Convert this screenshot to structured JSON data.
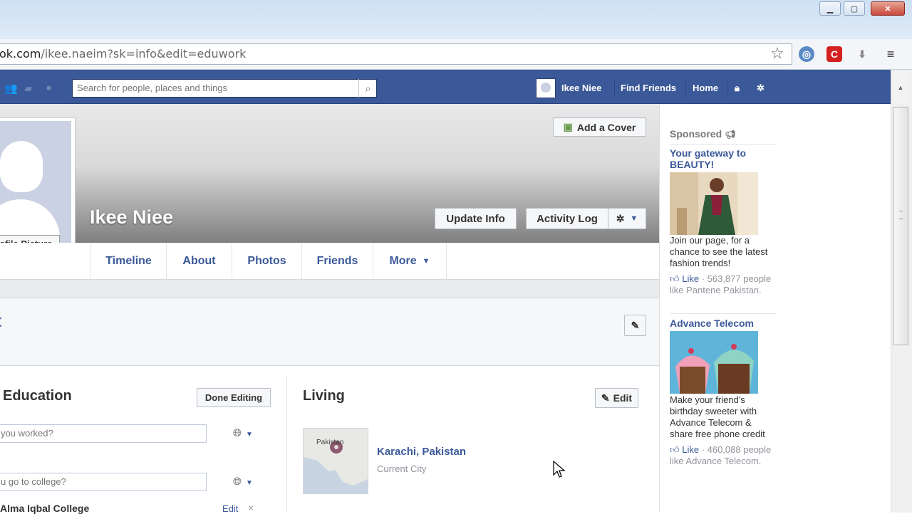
{
  "browser": {
    "url_domain": "ok.com",
    "url_path": "/ikee.naeim?sk=info&edit=eduwork",
    "window_buttons": [
      "▭",
      "▢",
      "✕"
    ]
  },
  "fb_header": {
    "search_placeholder": "Search for people, places and things",
    "user_name": "Ikee Niee",
    "find_friends": "Find Friends",
    "home": "Home"
  },
  "profile": {
    "name": "Ikee Niee",
    "picture_button": "ofile Picture",
    "add_cover": "Add a Cover",
    "update_info": "Update Info",
    "activity_log": "Activity Log"
  },
  "tabs": [
    {
      "label": "Timeline"
    },
    {
      "label": "About"
    },
    {
      "label": "Photos"
    },
    {
      "label": "Friends"
    },
    {
      "label": "More"
    }
  ],
  "about": {
    "title_fragment": "t",
    "education": {
      "title": "Education",
      "done_editing": "Done Editing",
      "work_placeholder": "you worked?",
      "college_placeholder": "u go to college?",
      "college_entry": "Alma Iqbal College",
      "edit": "Edit",
      "remove": "×"
    },
    "living": {
      "title": "Living",
      "edit": "Edit",
      "map_label": "Pakistan",
      "city": "Karachi, Pakistan",
      "city_type": "Current City"
    }
  },
  "sidebar": {
    "sponsored": "Sponsored",
    "ads": [
      {
        "title": "Your gateway to BEAUTY!",
        "text": "Join our page, for a chance to see the latest fashion trends!",
        "like": "Like",
        "stats": " · 563,877 people like Pantene Pakistan."
      },
      {
        "title": "Advance Telecom",
        "text": "Make your friend's birthday sweeter with Advance Telecom & share free phone credit",
        "like": "Like",
        "stats": " · 460,088 people like Advance Telecom."
      }
    ]
  },
  "colors": {
    "fb_blue": "#3b5998",
    "link": "#3b5998",
    "muted": "#90949c"
  },
  "icons": [
    "star-icon",
    "extension-icon",
    "menu-icon",
    "search-icon",
    "friends-icon",
    "messages-icon",
    "globe-icon",
    "lock-icon",
    "gear-icon",
    "pencil-icon",
    "camera-icon",
    "map-pin-icon",
    "like-icon",
    "cursor-icon"
  ]
}
